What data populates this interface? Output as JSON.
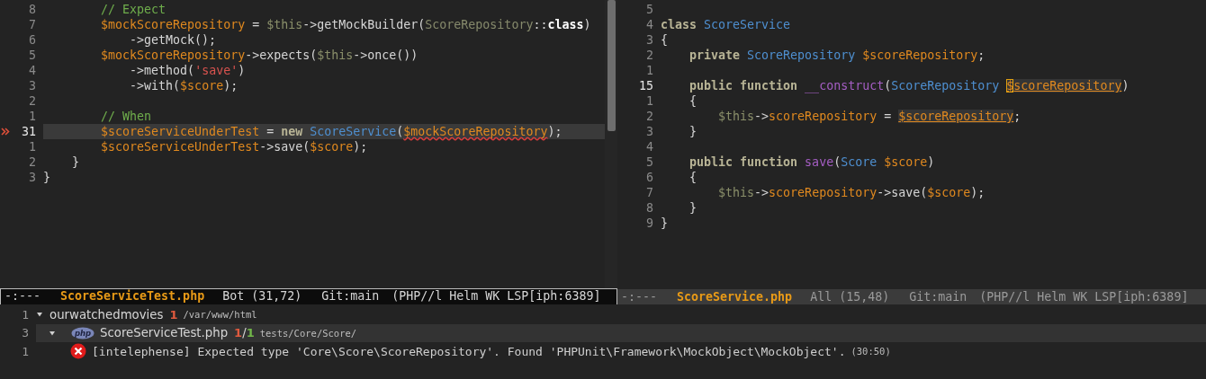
{
  "left_pane": {
    "lines": [
      {
        "number": "8",
        "tokens": [
          {
            "text": "        // Expect",
            "kind": "comment"
          }
        ]
      },
      {
        "number": "7",
        "tokens": [
          {
            "text": "        $mockScoreRepository",
            "kind": "var"
          },
          {
            "text": " = ",
            "kind": "plain"
          },
          {
            "text": "$this",
            "kind": "this"
          },
          {
            "text": "->getMockBuilder(",
            "kind": "plain"
          },
          {
            "text": "ScoreRepository",
            "kind": "dimtype"
          },
          {
            "text": "::",
            "kind": "plain"
          },
          {
            "text": "class",
            "kind": "bold"
          },
          {
            "text": ")",
            "kind": "plain"
          }
        ]
      },
      {
        "number": "6",
        "tokens": [
          {
            "text": "            ->getMock();",
            "kind": "plain"
          }
        ]
      },
      {
        "number": "5",
        "tokens": [
          {
            "text": "        $mockScoreRepository",
            "kind": "var"
          },
          {
            "text": "->expects(",
            "kind": "plain"
          },
          {
            "text": "$this",
            "kind": "this"
          },
          {
            "text": "->once())",
            "kind": "plain"
          }
        ]
      },
      {
        "number": "4",
        "tokens": [
          {
            "text": "            ->method(",
            "kind": "plain"
          },
          {
            "text": "'save'",
            "kind": "string"
          },
          {
            "text": ")",
            "kind": "plain"
          }
        ]
      },
      {
        "number": "3",
        "tokens": [
          {
            "text": "            ->with(",
            "kind": "plain"
          },
          {
            "text": "$score",
            "kind": "var"
          },
          {
            "text": ");",
            "kind": "plain"
          }
        ]
      },
      {
        "number": "2"
      },
      {
        "number": "1",
        "tokens": [
          {
            "text": "        // When",
            "kind": "comment"
          }
        ]
      },
      {
        "number": "31",
        "current": true,
        "highlighted": true,
        "error_mark": true,
        "tokens": [
          {
            "text": "        $scoreServiceUnderTest",
            "kind": "var"
          },
          {
            "text": " = ",
            "kind": "plain"
          },
          {
            "text": "new",
            "kind": "keyword"
          },
          {
            "text": " ScoreService",
            "kind": "type"
          },
          {
            "text": "(",
            "kind": "plain"
          },
          {
            "text": "$mockScoreRepository",
            "kind": "var",
            "squiggle": true
          },
          {
            "text": ");",
            "kind": "plain"
          }
        ]
      },
      {
        "number": "1",
        "tokens": [
          {
            "text": "        $scoreServiceUnderTest",
            "kind": "var"
          },
          {
            "text": "->save(",
            "kind": "plain"
          },
          {
            "text": "$score",
            "kind": "var"
          },
          {
            "text": ");",
            "kind": "plain"
          }
        ]
      },
      {
        "number": "2",
        "tokens": [
          {
            "text": "    }",
            "kind": "plain"
          }
        ]
      },
      {
        "number": "3",
        "tokens": [
          {
            "text": "}",
            "kind": "plain"
          }
        ]
      }
    ]
  },
  "right_pane": {
    "lines": [
      {
        "number": "5"
      },
      {
        "number": "4",
        "tokens": [
          {
            "text": "class",
            "kind": "keyword"
          },
          {
            "text": " ScoreService",
            "kind": "type"
          }
        ]
      },
      {
        "number": "3",
        "tokens": [
          {
            "text": "{",
            "kind": "plain"
          }
        ]
      },
      {
        "number": "2",
        "tokens": [
          {
            "text": "    private",
            "kind": "keyword"
          },
          {
            "text": " ScoreRepository",
            "kind": "type"
          },
          {
            "text": " $scoreRepository",
            "kind": "var"
          },
          {
            "text": ";",
            "kind": "plain"
          }
        ]
      },
      {
        "number": "1"
      },
      {
        "number": "15",
        "current": true,
        "tokens": [
          {
            "text": "    public function",
            "kind": "keyword"
          },
          {
            "text": " __construct",
            "kind": "func"
          },
          {
            "text": "(",
            "kind": "plain"
          },
          {
            "text": "ScoreRepository ",
            "kind": "type"
          },
          {
            "text": "$",
            "kind": "var",
            "cursor": true,
            "underline": true,
            "highlight": true
          },
          {
            "text": "scoreRepository",
            "kind": "var",
            "underline": true,
            "highlight": true
          },
          {
            "text": ")",
            "kind": "plain"
          }
        ]
      },
      {
        "number": "1",
        "tokens": [
          {
            "text": "    {",
            "kind": "plain"
          }
        ]
      },
      {
        "number": "2",
        "tokens": [
          {
            "text": "        $this",
            "kind": "this"
          },
          {
            "text": "->",
            "kind": "plain"
          },
          {
            "text": "scoreRepository",
            "kind": "var"
          },
          {
            "text": " = ",
            "kind": "plain"
          },
          {
            "text": "$scoreRepository",
            "kind": "var",
            "underline": true,
            "highlight": true
          },
          {
            "text": ";",
            "kind": "plain"
          }
        ]
      },
      {
        "number": "3",
        "tokens": [
          {
            "text": "    }",
            "kind": "plain"
          }
        ]
      },
      {
        "number": "4"
      },
      {
        "number": "5",
        "tokens": [
          {
            "text": "    public function",
            "kind": "keyword"
          },
          {
            "text": " save",
            "kind": "func"
          },
          {
            "text": "(",
            "kind": "plain"
          },
          {
            "text": "Score",
            "kind": "type"
          },
          {
            "text": " $score",
            "kind": "var"
          },
          {
            "text": ")",
            "kind": "plain"
          }
        ]
      },
      {
        "number": "6",
        "tokens": [
          {
            "text": "    {",
            "kind": "plain"
          }
        ]
      },
      {
        "number": "7",
        "tokens": [
          {
            "text": "        $this",
            "kind": "this"
          },
          {
            "text": "->",
            "kind": "plain"
          },
          {
            "text": "scoreRepository",
            "kind": "var"
          },
          {
            "text": "->save(",
            "kind": "plain"
          },
          {
            "text": "$score",
            "kind": "var"
          },
          {
            "text": ");",
            "kind": "plain"
          }
        ]
      },
      {
        "number": "8",
        "tokens": [
          {
            "text": "    }",
            "kind": "plain"
          }
        ]
      },
      {
        "number": "9",
        "tokens": [
          {
            "text": "}",
            "kind": "plain"
          }
        ]
      }
    ]
  },
  "mode_lines": [
    {
      "active": true,
      "state": "-:---",
      "buffer": "ScoreServiceTest.php",
      "position": "Bot (31,72)",
      "branch": "Git:main",
      "modes": "(PHP//l Helm WK LSP[iph:6389]"
    },
    {
      "active": false,
      "state": "-:---",
      "buffer": "ScoreService.php",
      "position": "All (15,48)",
      "branch": "Git:main",
      "modes": "(PHP//l Helm WK LSP[iph:6389]"
    }
  ],
  "diagnostics": {
    "tree": [
      {
        "line_number": "1",
        "expanded": true,
        "selected": false,
        "name": "ourwatchedmovies",
        "count": "1",
        "path": "/var/www/html",
        "children": [
          {
            "line_number": "3",
            "expanded": true,
            "selected": true,
            "icon_label": "php",
            "name": "ScoreServiceTest.php",
            "errors": "1",
            "separator": "/",
            "total": "1",
            "path": "tests/Core/Score/",
            "children": [
              {
                "line_number": "1",
                "selected": false,
                "kind": "error",
                "message": "[intelephense] Expected type 'Core\\Score\\ScoreRepository'. Found 'PHPUnit\\Framework\\MockObject\\MockObject'.",
                "position": "(30:50)"
              }
            ]
          }
        ]
      }
    ]
  }
}
